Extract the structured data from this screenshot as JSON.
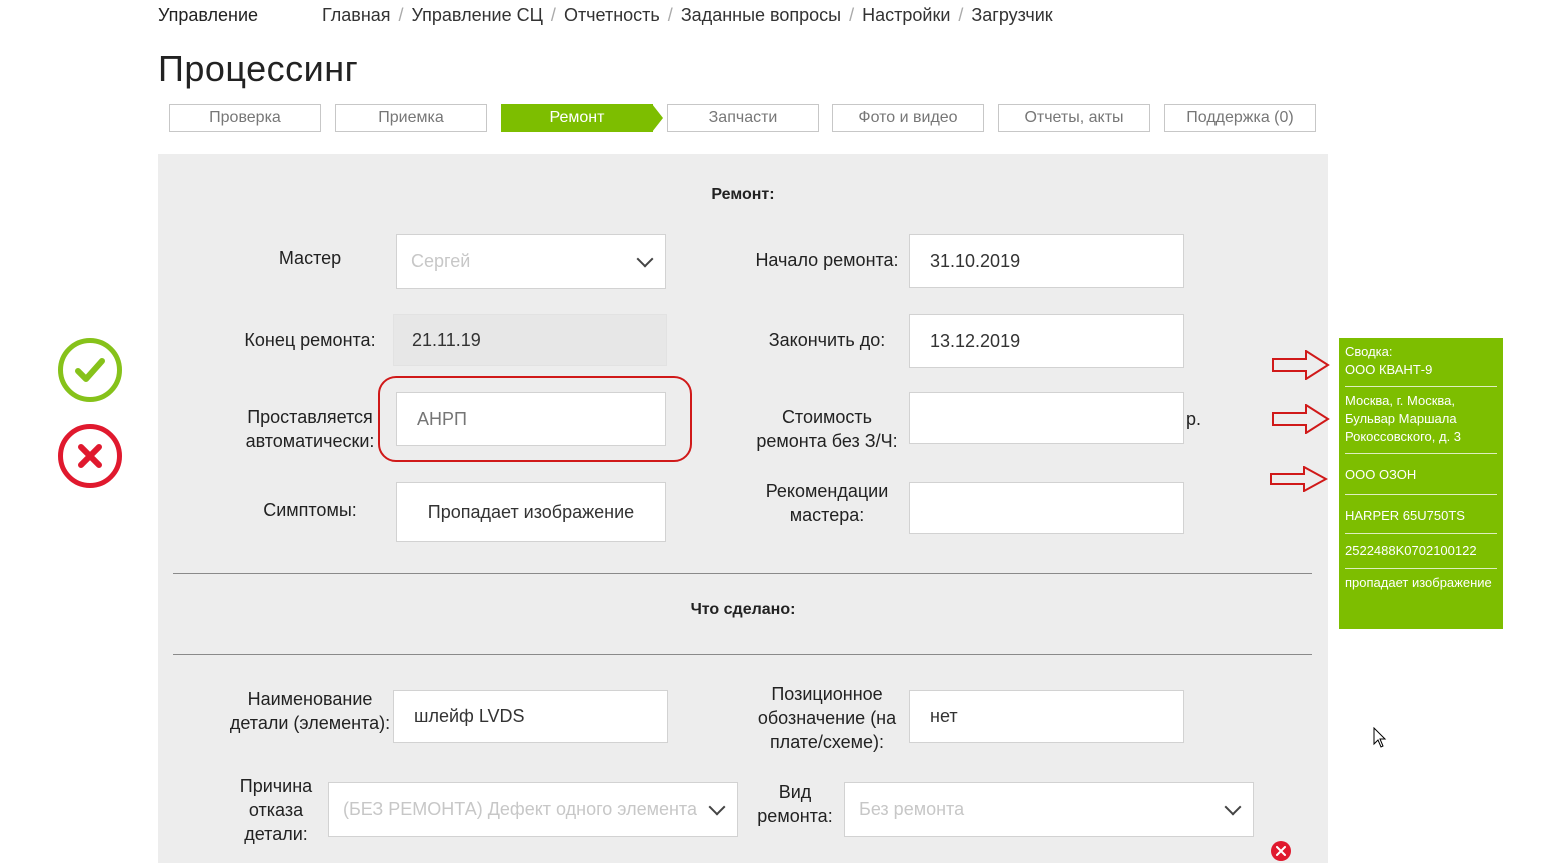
{
  "header": {
    "brand": "Управление",
    "breadcrumbs": [
      "Главная",
      "Управление СЦ",
      "Отчетность",
      "Заданные вопросы",
      "Настройки",
      "Загрузчик"
    ],
    "title": "Процессинг"
  },
  "steps": [
    "Проверка",
    "Приемка",
    "Ремонт",
    "Запчасти",
    "Фото и видео",
    "Отчеты, акты",
    "Поддержка (0)"
  ],
  "active_step": "Ремонт",
  "repair": {
    "section_title": "Ремонт:",
    "master_label": "Мастер",
    "master_value": "Сергей",
    "start_label": "Начало ремонта:",
    "start_value": "31.10.2019",
    "end_label": "Конец ремонта:",
    "end_value": "21.11.19",
    "finish_by_label": "Закончить до:",
    "finish_by_value": "13.12.2019",
    "auto_label": "Проставляется автоматически:",
    "auto_placeholder": "АНРП",
    "cost_label": "Стоимость ремонта без З/Ч:",
    "cost_value": "",
    "cost_unit": "р.",
    "symptoms_label": "Симптомы:",
    "symptoms_value": "Пропадает изображение",
    "recommend_label": "Рекомендации мастера:",
    "recommend_value": ""
  },
  "done": {
    "section_title": "Что сделано:",
    "part_name_label": "Наименование детали (элемента):",
    "part_name_value": "шлейф LVDS",
    "position_label": "Позиционное обозначение (на плате/схеме):",
    "position_value": "нет",
    "reason_label": "Причина отказа детали:",
    "reason_value": "(БЕЗ РЕМОНТА) Дефект одного элемента",
    "repair_type_label": "Вид ремонта:",
    "repair_type_value": "Без ремонта"
  },
  "summary": {
    "items": [
      "Сводка:\nООО КВАНТ-9",
      "Москва, г. Москва, Бульвар Маршала Рокоссовского, д. 3",
      "ООО ОЗОН",
      "HARPER 65U750TS",
      "2522488K0702100122",
      "пропадает изображение"
    ]
  },
  "colors": {
    "accent": "#7dbe00",
    "ok": "#86c21a",
    "danger": "#e0192e",
    "annotation": "#d01919"
  },
  "icons": [
    "check-icon",
    "close-icon",
    "chevron-down-icon",
    "arrow-right-icon",
    "mouse-cursor-icon"
  ]
}
